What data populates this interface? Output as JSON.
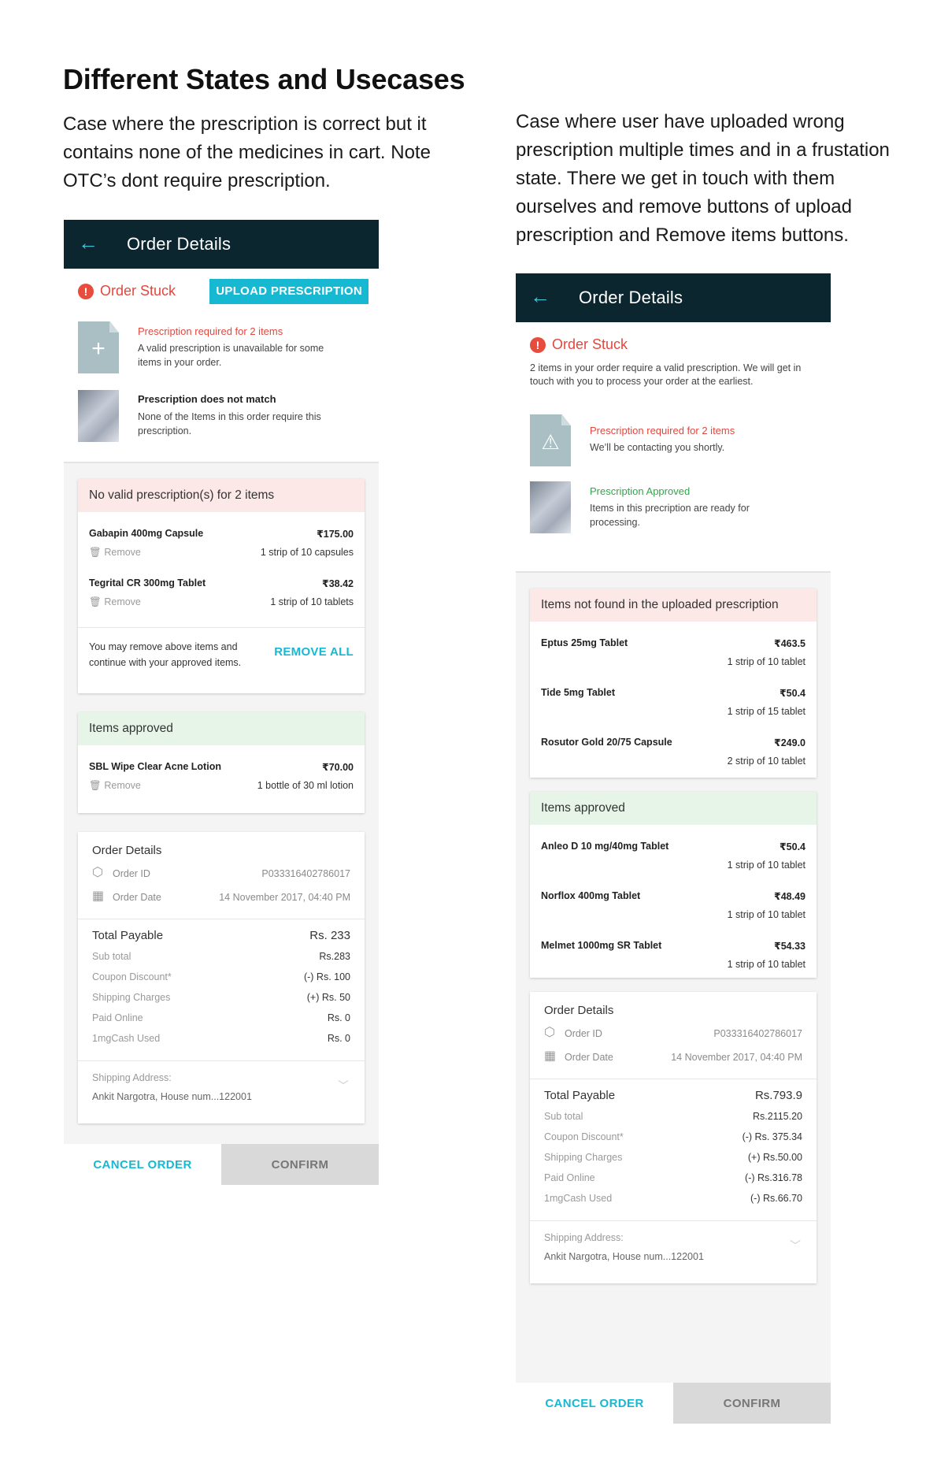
{
  "heading": "Different States and Usecases",
  "case1": {
    "lines": [
      "Case where the prescription is correct but it",
      "contains none of the medicines in cart. Note",
      "OTC’s dont require prescription."
    ],
    "appbar_title": "Order Details",
    "back_icon": "←",
    "stuck_label": "Order Stuck",
    "upload_button": "UPLOAD PRESCRIPTION",
    "presc1_title": "Prescription required for 2 items",
    "presc1_desc": "A valid prescription is unavailable for some items in your order.",
    "presc2_title": "Prescription does not match",
    "presc2_desc": "None of the Items in this order require this prescription.",
    "invalid_header": "No valid prescription(s) for 2 items",
    "invalid_items": [
      {
        "name": "Gabapin 400mg Capsule",
        "price": "₹175.00",
        "remove": "Remove",
        "qty": "1 strip of 10 capsules"
      },
      {
        "name": "Tegrital CR 300mg Tablet",
        "price": "₹38.42",
        "remove": "Remove",
        "qty": "1 strip of 10 tablets"
      }
    ],
    "remove_all_text": "You may remove above items and continue with your approved items.",
    "remove_all_button": "REMOVE ALL",
    "approved_header": "Items approved",
    "approved_items": [
      {
        "name": "SBL Wipe Clear Acne Lotion",
        "price": "₹70.00",
        "remove": "Remove",
        "qty": "1 bottle of  30 ml lotion"
      }
    ],
    "order_details": {
      "title": "Order Details",
      "order_id_label": "Order ID",
      "order_id": "P033316402786017",
      "order_date_label": "Order Date",
      "order_date": "14 November 2017, 04:40 PM",
      "total_label": "Total Payable",
      "total": "Rs. 233",
      "rows": [
        {
          "label": "Sub total",
          "value": "Rs.283"
        },
        {
          "label": "Coupon Discount*",
          "value": "(-) Rs. 100"
        },
        {
          "label": "Shipping Charges",
          "value": "(+) Rs. 50"
        },
        {
          "label": "Paid Online",
          "value": "Rs. 0"
        },
        {
          "label": "1mgCash Used",
          "value": "Rs. 0"
        }
      ],
      "shipping_label": "Shipping Address:",
      "shipping_address": "Ankit Nargotra, House num...122001"
    },
    "cancel_button": "CANCEL ORDER",
    "confirm_button": "CONFIRM"
  },
  "case2": {
    "lines": [
      "Case where user have uploaded wrong",
      "prescription multiple times and in a frustation",
      "state. There we get in touch with them",
      "ourselves and remove buttons of upload",
      "prescription and Remove items buttons."
    ],
    "appbar_title": "Order Details",
    "back_icon": "←",
    "stuck_label": "Order Stuck",
    "stuck_message": "2 items in your order require a valid prescription. We will get in touch with you to process your order at the earliest.",
    "presc1_title": "Prescription required for 2 items",
    "presc1_desc": "We’ll be contacting you shortly.",
    "presc2_title": "Prescription Approved",
    "presc2_desc": "Items in this precription are ready for processing.",
    "notfound_header": "Items not found in the uploaded prescription",
    "notfound_items": [
      {
        "name": "Eptus 25mg Tablet",
        "price": "₹463.5",
        "qty": "1 strip of 10 tablet"
      },
      {
        "name": "Tide 5mg Tablet",
        "price": "₹50.4",
        "qty": "1 strip of 15 tablet"
      },
      {
        "name": "Rosutor Gold 20/75 Capsule",
        "price": "₹249.0",
        "qty": "2 strip of 10 tablet"
      }
    ],
    "approved_header": "Items approved",
    "approved_items": [
      {
        "name": "Anleo D 10 mg/40mg Tablet",
        "price": "₹50.4",
        "qty": "1 strip of 10 tablet"
      },
      {
        "name": "Norflox 400mg Tablet",
        "price": "₹48.49",
        "qty": "1 strip of 10 tablet"
      },
      {
        "name": "Melmet 1000mg SR Tablet",
        "price": "₹54.33",
        "qty": "1 strip of 10 tablet"
      }
    ],
    "order_details": {
      "title": "Order Details",
      "order_id_label": "Order ID",
      "order_id": "P033316402786017",
      "order_date_label": "Order Date",
      "order_date": "14 November 2017, 04:40 PM",
      "total_label": "Total Payable",
      "total": "Rs.793.9",
      "rows": [
        {
          "label": "Sub total",
          "value": "Rs.2115.20"
        },
        {
          "label": "Coupon Discount*",
          "value": "(-) Rs. 375.34"
        },
        {
          "label": "Shipping Charges",
          "value": "(+) Rs.50.00"
        },
        {
          "label": "Paid Online",
          "value": "(-) Rs.316.78"
        },
        {
          "label": "1mgCash Used",
          "value": "(-) Rs.66.70"
        }
      ],
      "shipping_label": "Shipping Address:",
      "shipping_address": "Ankit Nargotra, House num...122001"
    },
    "cancel_button": "CANCEL ORDER",
    "confirm_button": "CONFIRM"
  },
  "colors": {
    "appbar": "#0c2630",
    "accent": "#17b8d2",
    "error": "#e0483f",
    "success": "#2ea84a"
  }
}
